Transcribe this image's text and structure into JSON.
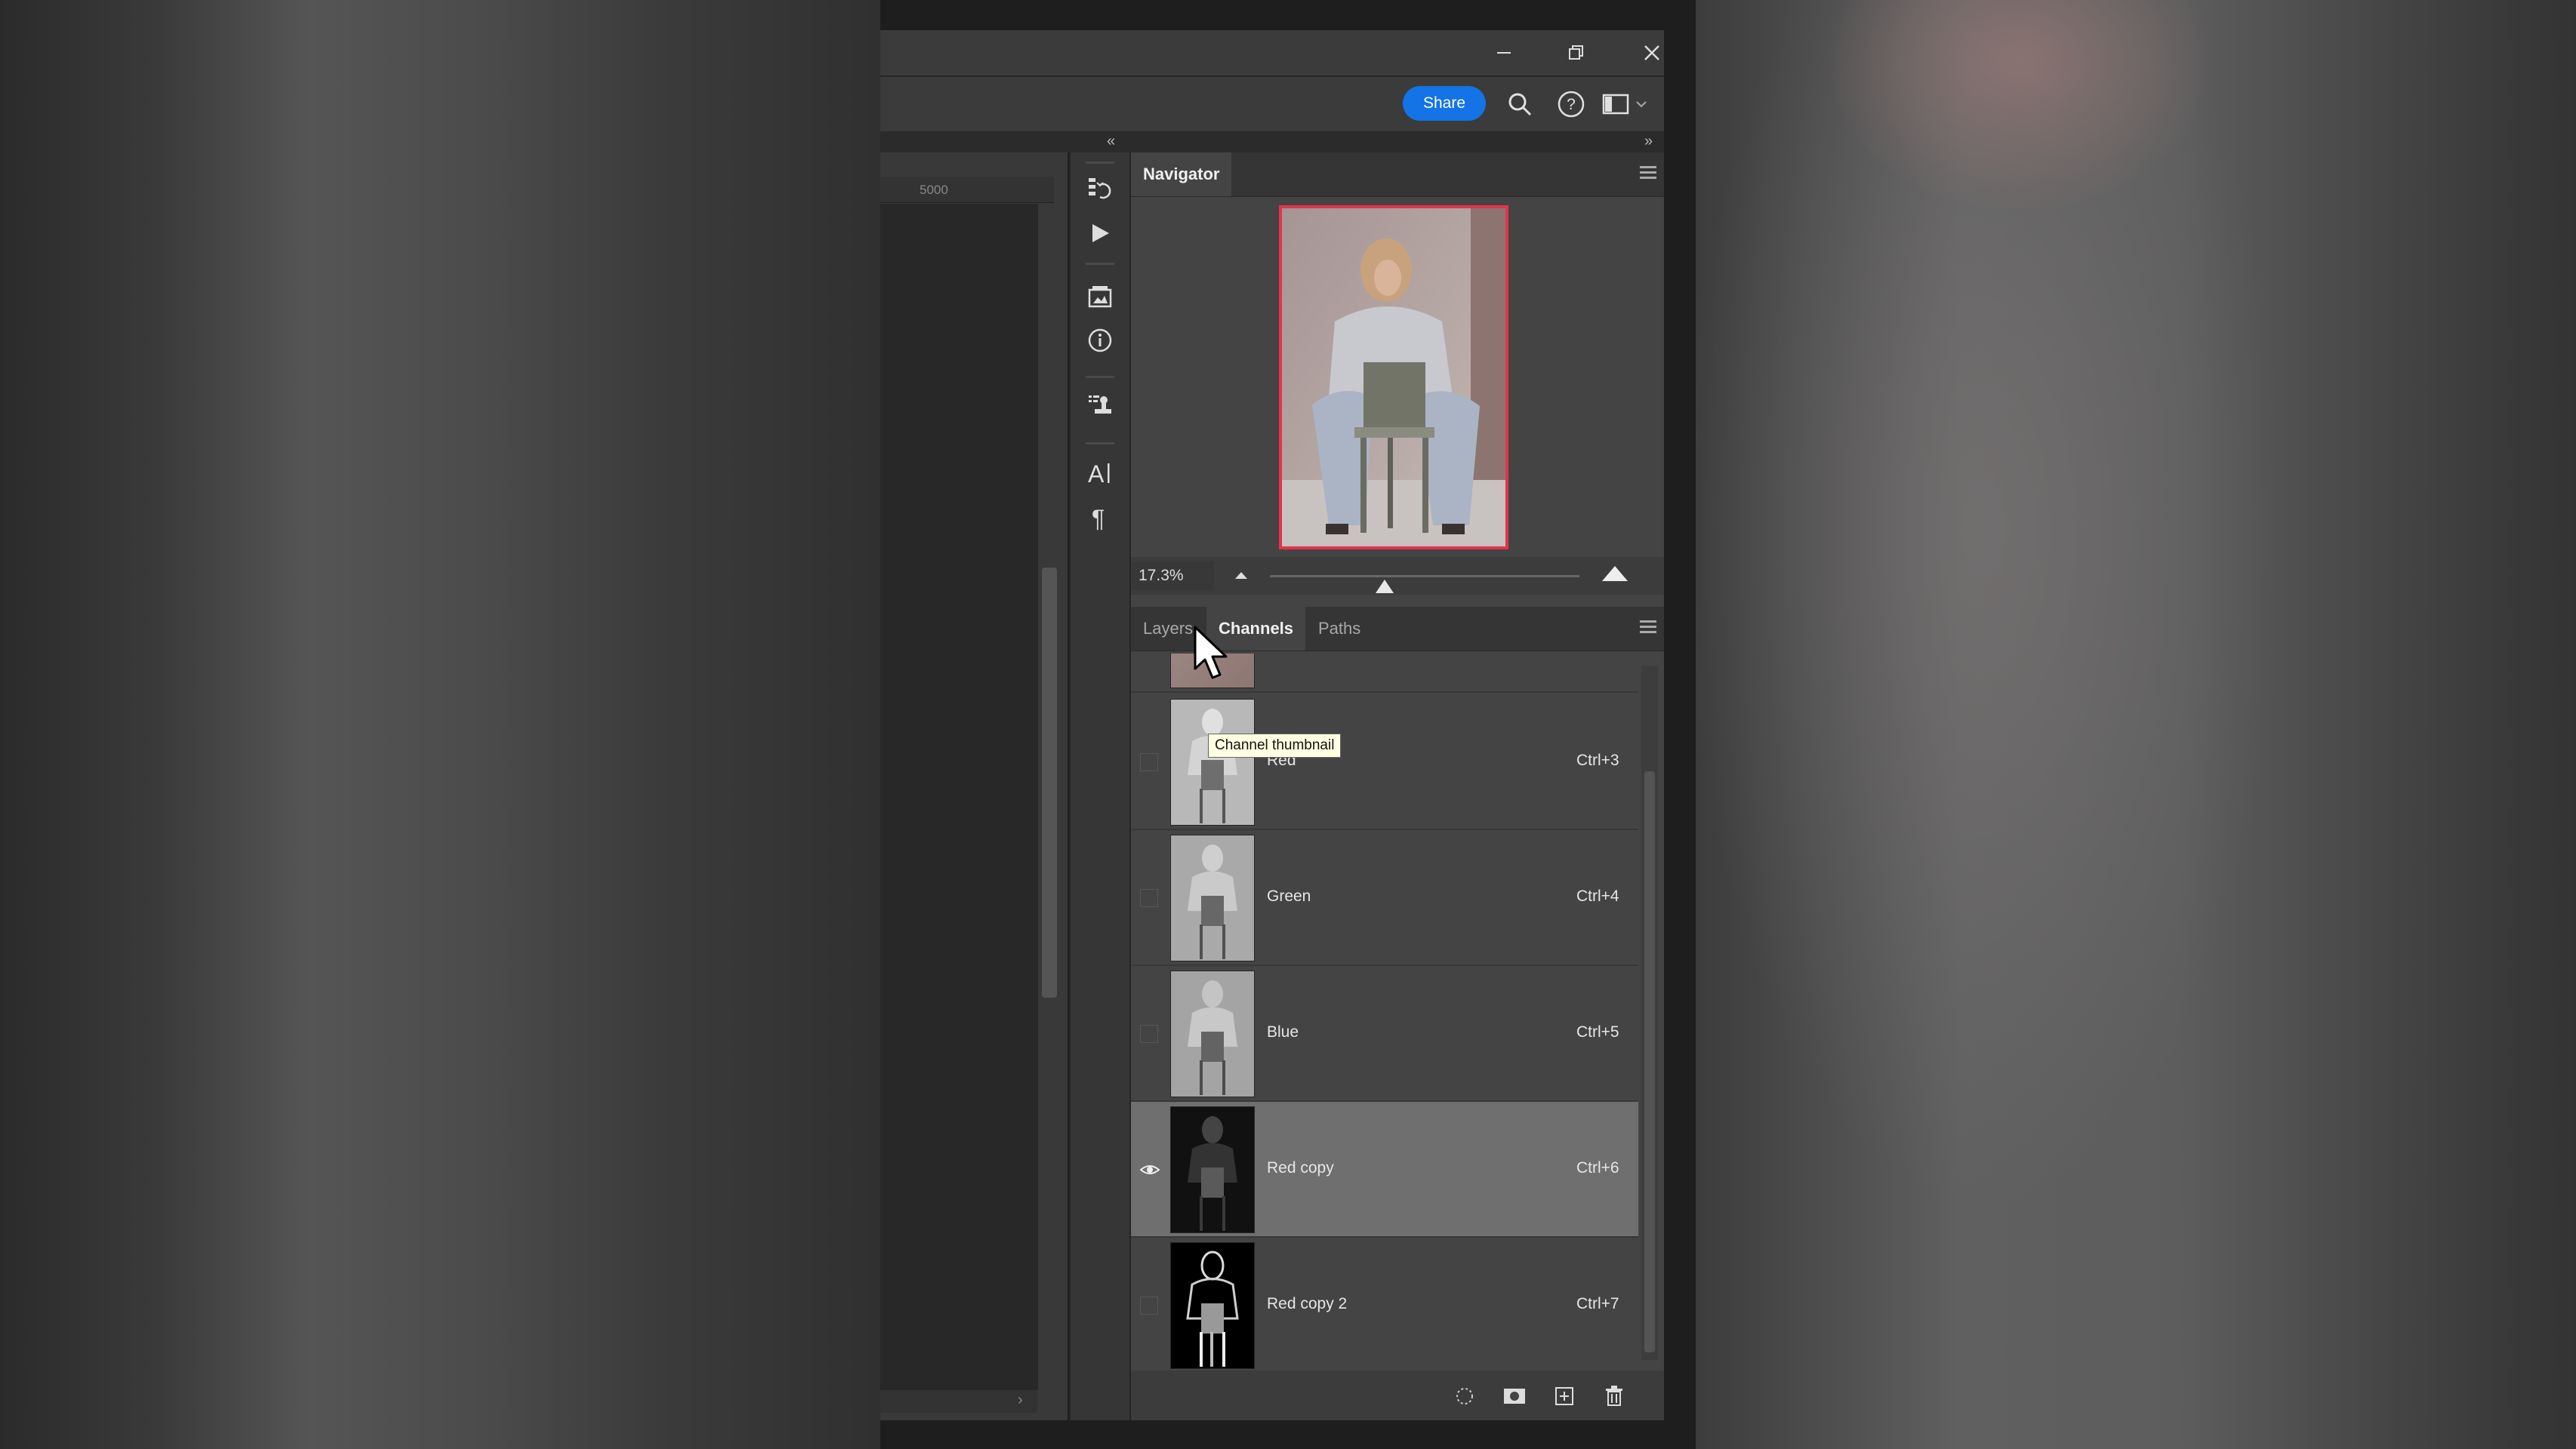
{
  "window": {
    "controls": {
      "minimize": "minimize-icon",
      "restore": "restore-icon",
      "close": "close-icon"
    }
  },
  "appbar": {
    "share_label": "Share",
    "icons": [
      "search-icon",
      "help-icon",
      "workspace-icon"
    ]
  },
  "document": {
    "ruler_mark": "5000"
  },
  "tool_strip": [
    "history-icon",
    "play-actions-icon",
    "libraries-icon",
    "info-icon",
    "clone-source-icon",
    "character-icon",
    "paragraph-icon"
  ],
  "navigator": {
    "title": "Navigator",
    "zoom": "17.3%",
    "zoom_level_fraction": 0.37
  },
  "channels_panel": {
    "tabs": [
      {
        "label": "Layers",
        "active": false
      },
      {
        "label": "Channels",
        "active": true
      },
      {
        "label": "Paths",
        "active": false
      }
    ],
    "rows": [
      {
        "name": "Red",
        "shortcut": "Ctrl+3",
        "visible": false,
        "selected": false,
        "tone": "light"
      },
      {
        "name": "Green",
        "shortcut": "Ctrl+4",
        "visible": false,
        "selected": false,
        "tone": "light"
      },
      {
        "name": "Blue",
        "shortcut": "Ctrl+5",
        "visible": false,
        "selected": false,
        "tone": "light"
      },
      {
        "name": "Red copy",
        "shortcut": "Ctrl+6",
        "visible": true,
        "selected": true,
        "tone": "dark"
      },
      {
        "name": "Red copy 2",
        "shortcut": "Ctrl+7",
        "visible": false,
        "selected": false,
        "tone": "contrast"
      }
    ],
    "footer_icons": [
      "load-selection-icon",
      "save-selection-icon",
      "new-channel-icon",
      "delete-channel-icon"
    ],
    "tooltip": "Channel thumbnail"
  },
  "colors": {
    "accent": "#1473e6",
    "navigator_frame": "#e5334b",
    "panel_bg": "#444444",
    "selected_row": "#6f6f6f"
  }
}
